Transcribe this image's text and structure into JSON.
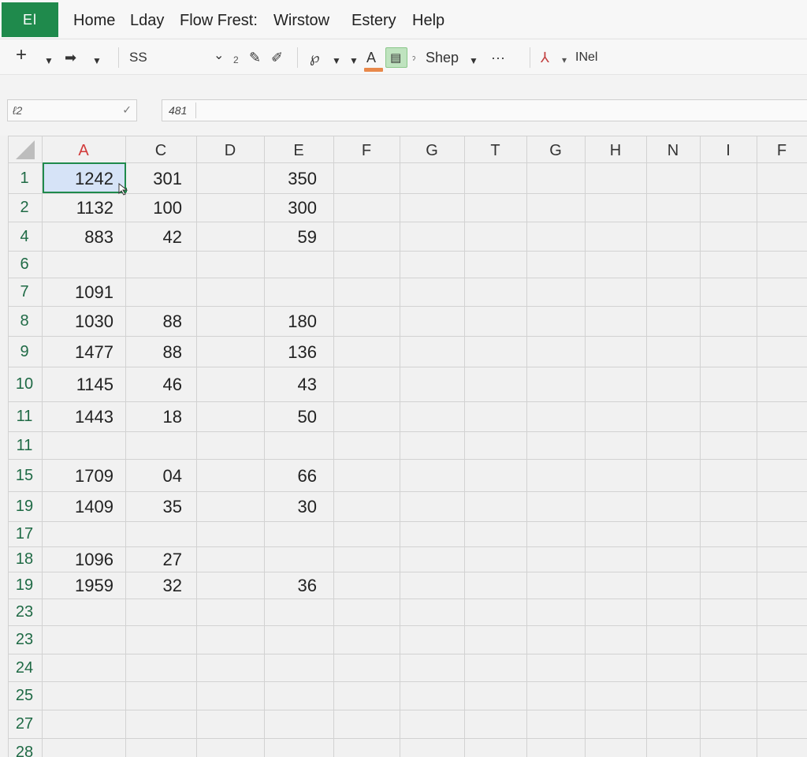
{
  "app": {
    "logo": "El"
  },
  "menu": [
    "Home",
    "Lday",
    "Flow Frest:",
    "Wirstow",
    "Estery",
    "Help"
  ],
  "toolbar": {
    "plus": "+",
    "font_name": "SS",
    "font_dropdown": "⌄",
    "small_glyph": "2",
    "font_color": "A",
    "shape_label": "Shep",
    "more": "···",
    "insert_label": "INel"
  },
  "name_box": {
    "value": "ℓ2"
  },
  "formula": {
    "value": "481"
  },
  "columns": [
    "A",
    "C",
    "D",
    "E",
    "F",
    "G",
    "T",
    "G",
    "H",
    "N",
    "I",
    "F"
  ],
  "rows": [
    {
      "num": "1",
      "A": "1242",
      "C": "301",
      "E": "350"
    },
    {
      "num": "2",
      "A": "1132",
      "C": "100",
      "E": "300"
    },
    {
      "num": "4",
      "A": "883",
      "C": "42",
      "E": "59"
    },
    {
      "num": "6",
      "A": "",
      "C": "",
      "E": ""
    },
    {
      "num": "7",
      "A": "1091",
      "C": "",
      "E": ""
    },
    {
      "num": "8",
      "A": "1030",
      "C": "88",
      "E": "180"
    },
    {
      "num": "9",
      "A": "1477",
      "C": "88",
      "E": "136"
    },
    {
      "num": "10",
      "A": "1145",
      "C": "46",
      "E": "43"
    },
    {
      "num": "11",
      "A": "1443",
      "C": "18",
      "E": "50"
    },
    {
      "num": "11",
      "A": "",
      "C": "",
      "E": ""
    },
    {
      "num": "15",
      "A": "1709",
      "C": "04",
      "E": "66"
    },
    {
      "num": "19",
      "A": "1409",
      "C": "35",
      "E": "30"
    },
    {
      "num": "17",
      "A": "",
      "C": "",
      "E": ""
    },
    {
      "num": "18",
      "A": "1096",
      "C": "27",
      "E": ""
    },
    {
      "num": "19",
      "A": "1959",
      "C": "32",
      "E": "36"
    },
    {
      "num": "23",
      "A": "",
      "C": "",
      "E": ""
    },
    {
      "num": "23",
      "A": "",
      "C": "",
      "E": ""
    },
    {
      "num": "24",
      "A": "",
      "C": "",
      "E": ""
    },
    {
      "num": "25",
      "A": "",
      "C": "",
      "E": ""
    },
    {
      "num": "27",
      "A": "",
      "C": "",
      "E": ""
    },
    {
      "num": "28",
      "A": "",
      "C": "",
      "E": ""
    }
  ],
  "colors": {
    "accent": "#1f8a4c",
    "selection": "#d6e3f7",
    "row_number": "#1f6a45",
    "col_a_header": "#d23b3b"
  }
}
